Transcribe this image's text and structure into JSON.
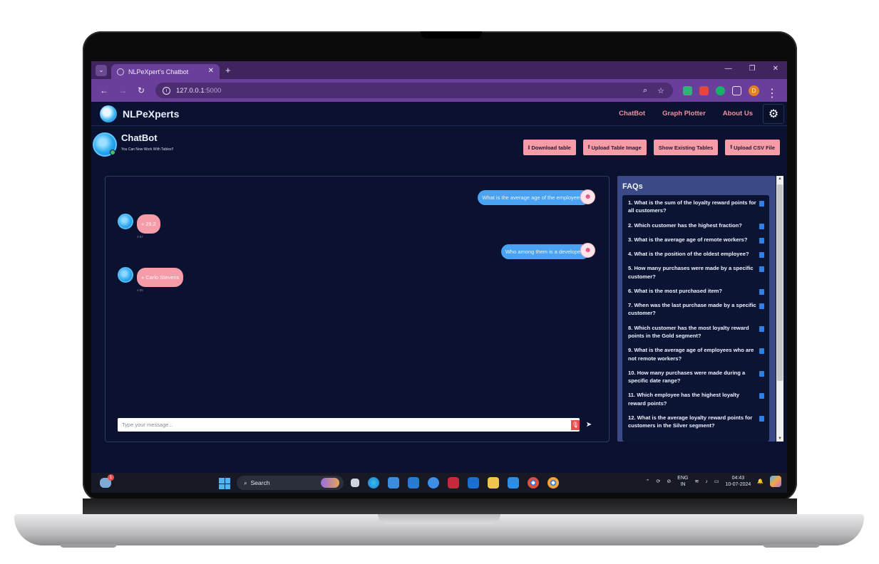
{
  "browser": {
    "tab_title": "NLPeXpert's Chatbot",
    "tab_close": "✕",
    "new_tab": "+",
    "url_host": "127.0.0.1",
    "url_port": ":5000"
  },
  "site": {
    "brand": "NLPeXperts",
    "nav": [
      "ChatBot",
      "Graph Plotter",
      "About Us"
    ]
  },
  "chat": {
    "title": "ChatBot",
    "subtitle": "You Can Now Work With Tables!!",
    "actions": [
      "Download table",
      "Upload Table Image",
      "Show Existing Tables",
      "Upload CSV File"
    ],
    "messages": [
      {
        "from": "user",
        "text": "What is the average age of the employees?"
      },
      {
        "from": "bot",
        "text": "» 29.2",
        "time": "4:57"
      },
      {
        "from": "user",
        "text": "Who among them is a developer?"
      },
      {
        "from": "bot",
        "text": "» Carlo Stevens",
        "time": "4:55"
      }
    ],
    "input_placeholder": "Type your message..."
  },
  "faq": {
    "title": "FAQs",
    "items": [
      "1. What is the sum of the loyalty reward points for all customers?",
      "2. Which customer has the highest fraction?",
      "3. What is the average age of remote workers?",
      "4. What is the position of the oldest employee?",
      "5. How many purchases were made by a specific customer?",
      "6. What is the most purchased item?",
      "7. When was the last purchase made by a specific customer?",
      "8. Which customer has the most loyalty reward points in the Gold segment?",
      "9. What is the average age of employees who are not remote workers?",
      "10. How many purchases were made during a specific date range?",
      "11. Which employee has the highest loyalty reward points?",
      "12. What is the average loyalty reward points for customers in the Silver segment?"
    ]
  },
  "taskbar": {
    "search": "Search",
    "weather_badge": "1",
    "lang": "ENG",
    "region": "IN",
    "time": "04:43",
    "date": "10-07-2024"
  }
}
